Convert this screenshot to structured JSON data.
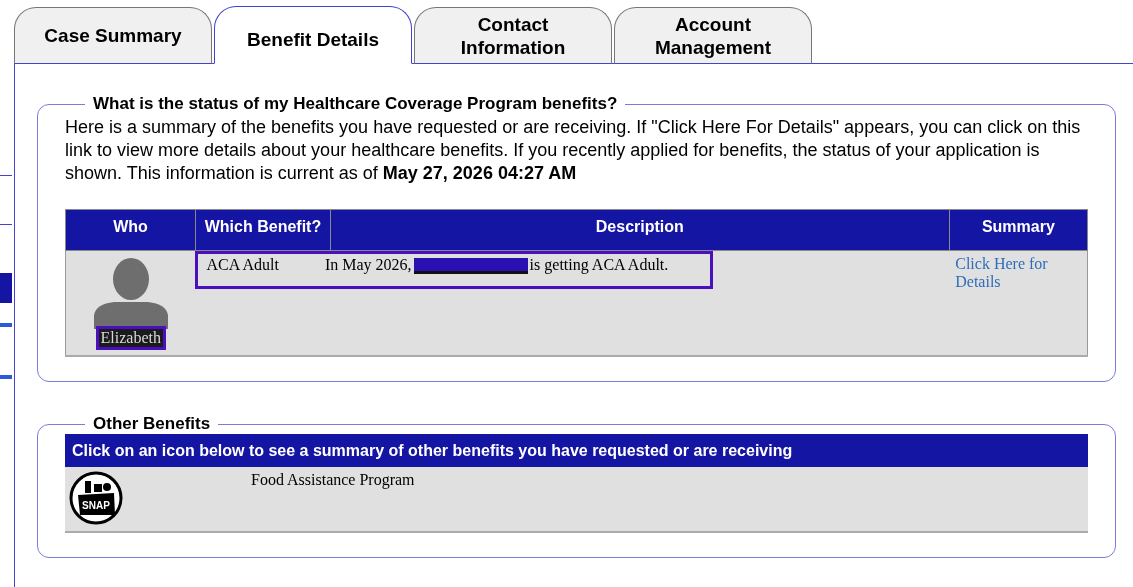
{
  "tabs": [
    {
      "label": "Case Summary",
      "selected": false
    },
    {
      "label": "Benefit Details",
      "selected": true
    },
    {
      "label": "Contact\nInformation",
      "selected": false
    },
    {
      "label": "Account\nManagement",
      "selected": false
    }
  ],
  "status_section": {
    "legend": "What is the status of my Healthcare Coverage Program benefits?",
    "intro": "Here is a summary of the benefits you have requested or are receiving. If \"Click Here For Details\" appears, you can click on this link to view more details about your healthcare benefits. If you recently applied for benefits, the status of your application is shown. This information is current as of **May 27, 2026 04:27 AM**",
    "table": {
      "columns": [
        "Who",
        "Which Benefit?",
        "Description",
        "Summary"
      ],
      "rows": [
        {
          "who": "Elizabeth",
          "benefit": "ACA Adult",
          "description_before": "In May 2026,",
          "description_after": "is getting ACA Adult.",
          "summary_link": "Click Here for Details"
        }
      ]
    }
  },
  "other_section": {
    "legend": "Other Benefits",
    "header": "Click on an icon below to see a summary of other benefits you have requested or are receiving",
    "items": [
      {
        "icon_label": "SNAP",
        "name": "Food Assistance Program"
      }
    ]
  }
}
